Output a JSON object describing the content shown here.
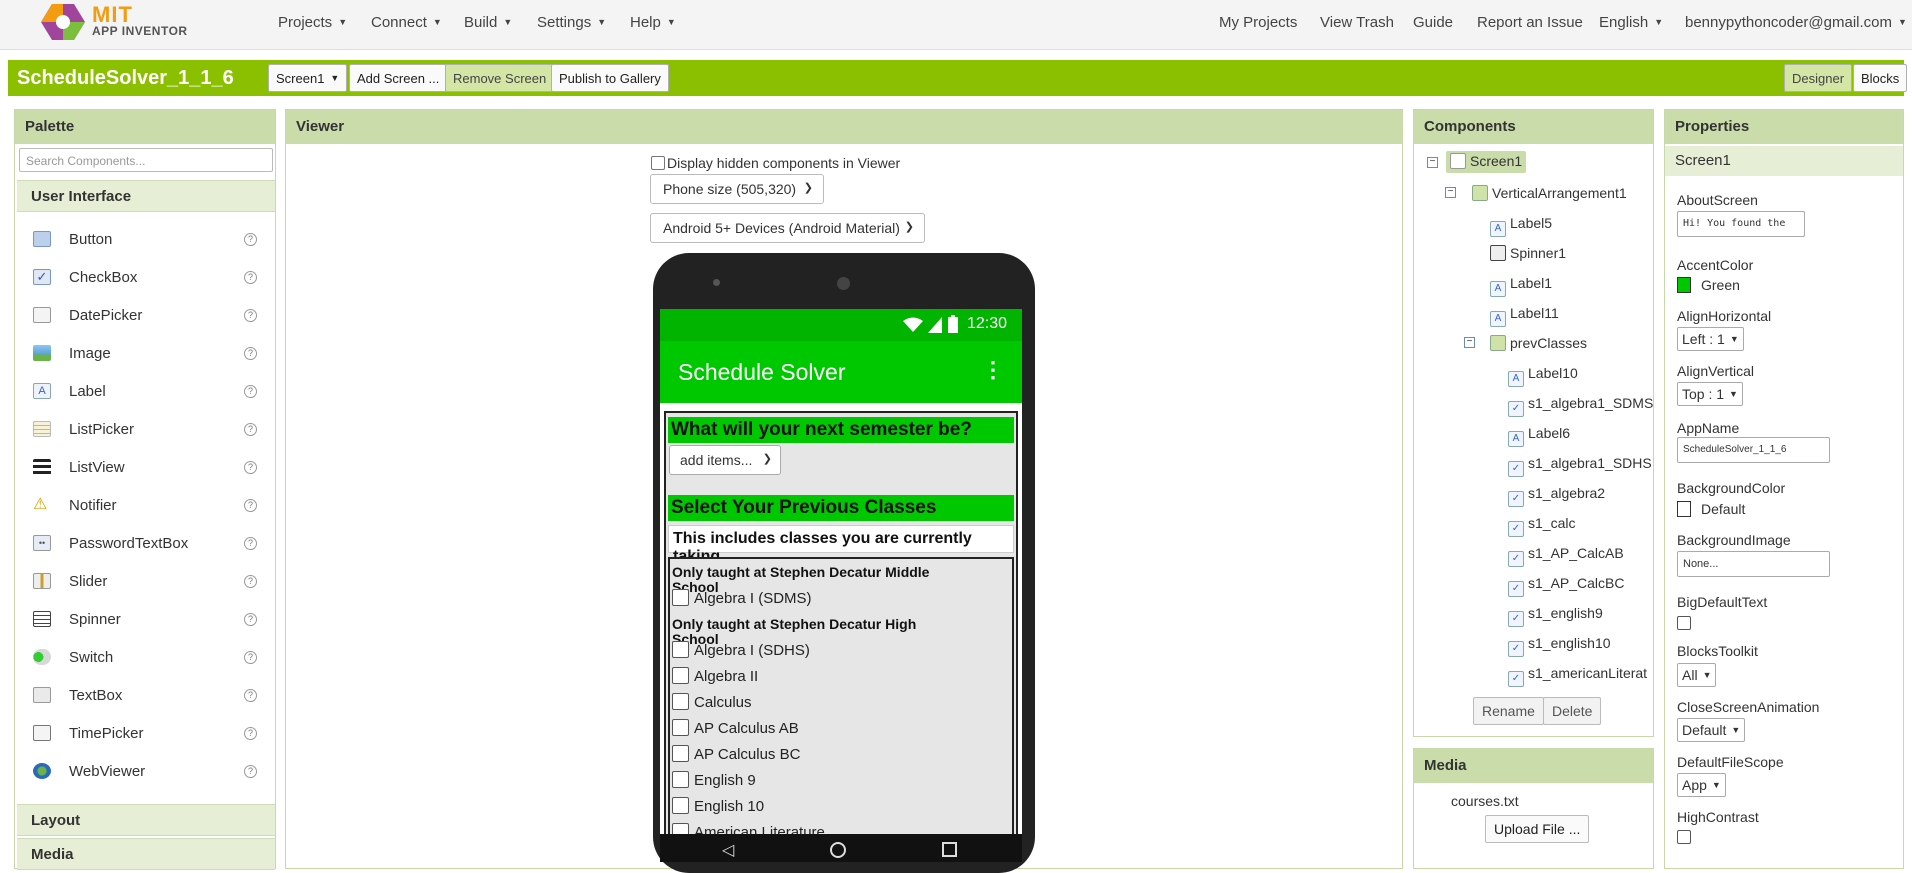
{
  "logo": {
    "mit": "MIT",
    "subtitle": "APP INVENTOR"
  },
  "topnav": {
    "left_menus": [
      "Projects",
      "Connect",
      "Build",
      "Settings",
      "Help"
    ],
    "right_links": [
      "My Projects",
      "View Trash",
      "Guide",
      "Report an Issue"
    ],
    "language": "English",
    "account": "bennypythoncoder@gmail.com"
  },
  "toolbar": {
    "project_name": "ScheduleSolver_1_1_6",
    "screen_select": "Screen1",
    "add_screen": "Add Screen ...",
    "remove_screen": "Remove Screen",
    "publish": "Publish to Gallery",
    "designer": "Designer",
    "blocks": "Blocks"
  },
  "palette": {
    "title": "Palette",
    "search_placeholder": "Search Components...",
    "category": "User Interface",
    "items": [
      {
        "label": "Button",
        "icon": "button-icon"
      },
      {
        "label": "CheckBox",
        "icon": "checkbox-icon"
      },
      {
        "label": "DatePicker",
        "icon": "datepicker-icon"
      },
      {
        "label": "Image",
        "icon": "image-icon"
      },
      {
        "label": "Label",
        "icon": "label-icon"
      },
      {
        "label": "ListPicker",
        "icon": "listpicker-icon"
      },
      {
        "label": "ListView",
        "icon": "listview-icon"
      },
      {
        "label": "Notifier",
        "icon": "notifier-icon"
      },
      {
        "label": "PasswordTextBox",
        "icon": "passwordtextbox-icon"
      },
      {
        "label": "Slider",
        "icon": "slider-icon"
      },
      {
        "label": "Spinner",
        "icon": "spinner-icon"
      },
      {
        "label": "Switch",
        "icon": "switch-icon"
      },
      {
        "label": "TextBox",
        "icon": "textbox-icon"
      },
      {
        "label": "TimePicker",
        "icon": "timepicker-icon"
      },
      {
        "label": "WebViewer",
        "icon": "webviewer-icon"
      }
    ],
    "help_glyph": "?",
    "more_categories": [
      "Layout",
      "Media"
    ]
  },
  "viewer": {
    "title": "Viewer",
    "hidden_toggle": "Display hidden components in Viewer",
    "size_select": "Phone size (505,320)",
    "theme_select": "Android 5+ Devices (Android Material)",
    "phone": {
      "time": "12:30",
      "app_title": "Schedule Solver",
      "menu_glyph": "⋮",
      "heading1": "What will your next semester be?",
      "spinner_text": "add items...",
      "heading2": "Select Your Previous Classes",
      "subheading": "This includes classes you are currently taking",
      "middle_label": "Only taught at Stephen Decatur Middle School",
      "high_label": "Only taught at Stephen Decatur High School",
      "classes": [
        "Algebra I (SDMS)",
        "Algebra I (SDHS)",
        "Algebra II",
        "Calculus",
        "AP Calculus AB",
        "AP Calculus BC",
        "English 9",
        "English 10",
        "American Literature"
      ]
    }
  },
  "components": {
    "title": "Components",
    "tree": [
      "Screen1",
      "VerticalArrangement1",
      "Label5",
      "Spinner1",
      "Label1",
      "Label11",
      "prevClasses",
      "Label10",
      "s1_algebra1_SDMS",
      "Label6",
      "s1_algebra1_SDHS",
      "s1_algebra2",
      "s1_calc",
      "s1_AP_CalcAB",
      "s1_AP_CalcBC",
      "s1_english9",
      "s1_english10",
      "s1_americanLiterat"
    ],
    "rename": "Rename",
    "delete": "Delete"
  },
  "media": {
    "title": "Media",
    "file": "courses.txt",
    "upload": "Upload File ..."
  },
  "properties": {
    "title": "Properties",
    "component": "Screen1",
    "about_label": "AboutScreen",
    "about_value": "Hi! You found the",
    "accent_label": "AccentColor",
    "accent_value": "Green",
    "accent_color": "#00c800",
    "alignh_label": "AlignHorizontal",
    "alignh_value": "Left : 1",
    "alignv_label": "AlignVertical",
    "alignv_value": "Top : 1",
    "appname_label": "AppName",
    "appname_value": "ScheduleSolver_1_1_6",
    "bgcolor_label": "BackgroundColor",
    "bgcolor_value": "Default",
    "bgimage_label": "BackgroundImage",
    "bgimage_value": "None...",
    "bigtext_label": "BigDefaultText",
    "blocks_label": "BlocksToolkit",
    "blocks_value": "All",
    "close_label": "CloseScreenAnimation",
    "close_value": "Default",
    "filescope_label": "DefaultFileScope",
    "filescope_value": "App",
    "contrast_label": "HighContrast"
  }
}
